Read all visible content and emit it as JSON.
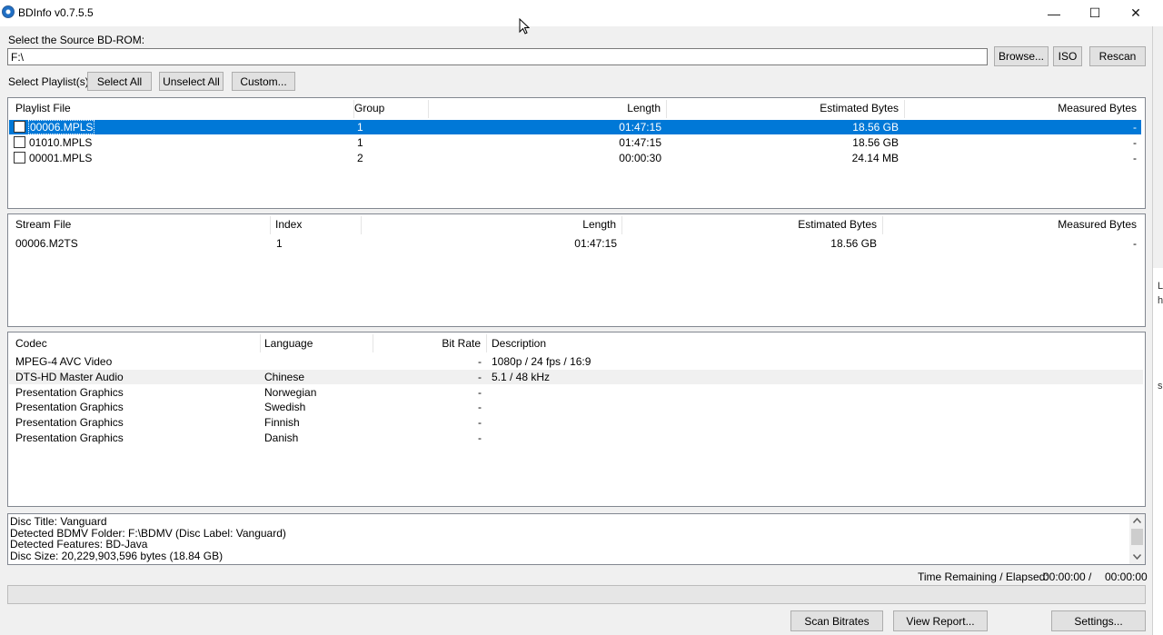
{
  "window": {
    "title": "BDInfo v0.7.5.5",
    "controls": {
      "minimize": "—",
      "maximize": "☐",
      "close": "✕"
    }
  },
  "source": {
    "label": "Select the Source BD-ROM:",
    "value": "F:\\",
    "browse": "Browse...",
    "iso": "ISO",
    "rescan": "Rescan"
  },
  "playlist_select": {
    "label": "Select Playlist(s):",
    "select_all": "Select All",
    "unselect_all": "Unselect All",
    "custom": "Custom..."
  },
  "playlists": {
    "headers": [
      "Playlist File",
      "Group",
      "Length",
      "Estimated Bytes",
      "Measured Bytes"
    ],
    "rows": [
      {
        "file": "00006.MPLS",
        "group": "1",
        "length": "01:47:15",
        "estimated": "18.56 GB",
        "measured": "-",
        "checked": false,
        "selected": true
      },
      {
        "file": "01010.MPLS",
        "group": "1",
        "length": "01:47:15",
        "estimated": "18.56 GB",
        "measured": "-",
        "checked": false,
        "selected": false
      },
      {
        "file": "00001.MPLS",
        "group": "2",
        "length": "00:00:30",
        "estimated": "24.14 MB",
        "measured": "-",
        "checked": false,
        "selected": false
      }
    ]
  },
  "streams": {
    "headers": [
      "Stream File",
      "Index",
      "Length",
      "Estimated Bytes",
      "Measured Bytes"
    ],
    "rows": [
      {
        "file": "00006.M2TS",
        "index": "1",
        "length": "01:47:15",
        "estimated": "18.56 GB",
        "measured": "-"
      }
    ]
  },
  "codecs": {
    "headers": [
      "Codec",
      "Language",
      "Bit Rate",
      "Description"
    ],
    "rows": [
      {
        "codec": "MPEG-4 AVC Video",
        "language": "",
        "bitrate": "-",
        "description": "1080p / 24 fps / 16:9"
      },
      {
        "codec": "DTS-HD Master Audio",
        "language": "Chinese",
        "bitrate": "-",
        "description": "5.1 / 48 kHz"
      },
      {
        "codec": "Presentation Graphics",
        "language": "Norwegian",
        "bitrate": "-",
        "description": ""
      },
      {
        "codec": "Presentation Graphics",
        "language": "Swedish",
        "bitrate": "-",
        "description": ""
      },
      {
        "codec": "Presentation Graphics",
        "language": "Finnish",
        "bitrate": "-",
        "description": ""
      },
      {
        "codec": "Presentation Graphics",
        "language": "Danish",
        "bitrate": "-",
        "description": ""
      }
    ]
  },
  "info": {
    "lines": [
      "Disc Title: Vanguard",
      "Detected BDMV Folder: F:\\BDMV (Disc Label: Vanguard)",
      "Detected Features: BD-Java",
      "Disc Size: 20,229,903,596 bytes (18.84 GB)"
    ]
  },
  "status": {
    "time_label": "Time Remaining / Elapsed:",
    "remaining": "00:00:00",
    "separator": "/",
    "elapsed": "00:00:00",
    "progress": 0
  },
  "footer": {
    "scan_bitrates": "Scan Bitrates",
    "view_report": "View Report...",
    "settings": "Settings..."
  },
  "edge_fragments": [
    "L",
    "h",
    "s"
  ]
}
